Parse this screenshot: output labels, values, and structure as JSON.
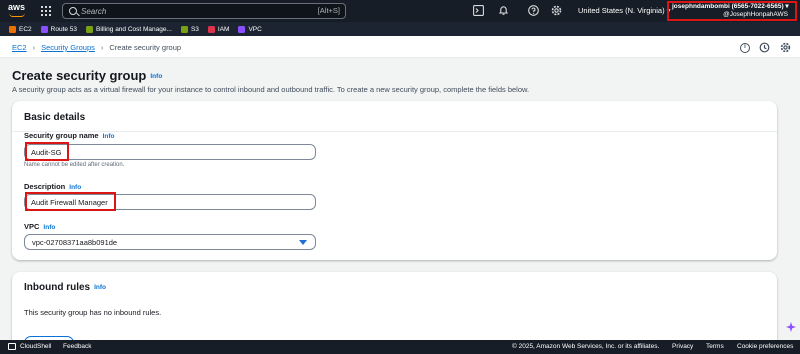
{
  "colors": {
    "nav_bg": "#161d26",
    "link": "#0972d3",
    "highlight": "#d91515",
    "aws_orange": "#ff9900"
  },
  "topnav": {
    "logo_text": "aws",
    "search_placeholder": "Search",
    "search_shortcut": "[Alt+S]",
    "region": "United States (N. Virginia) ▾",
    "account_name": "josephndambombi (6565-7022-6565) ▾",
    "account_alias": "@JosephHonpahAWS",
    "icons": [
      "apps-grid-icon",
      "terminal-icon",
      "bell-icon",
      "help-icon",
      "gear-icon"
    ]
  },
  "favorites": [
    {
      "label": "EC2",
      "color": "#ed7100"
    },
    {
      "label": "Route 53",
      "color": "#8c4fff"
    },
    {
      "label": "Billing and Cost Manage...",
      "color": "#7aa116"
    },
    {
      "label": "S3",
      "color": "#7aa116"
    },
    {
      "label": "IAM",
      "color": "#dd344c"
    },
    {
      "label": "VPC",
      "color": "#8c4fff"
    }
  ],
  "breadcrumb": {
    "items": [
      "EC2",
      "Security Groups"
    ],
    "current": "Create security group"
  },
  "page": {
    "title": "Create security group",
    "title_info": "Info",
    "description": "A security group acts as a virtual firewall for your instance to control inbound and outbound traffic. To create a new security group, complete the fields below."
  },
  "basic_details": {
    "title": "Basic details",
    "name_label": "Security group name",
    "name_info": "Info",
    "name_value": "Audit-SG",
    "name_hint": "Name cannot be edited after creation.",
    "desc_label": "Description",
    "desc_info": "Info",
    "desc_value": "Audit Firewall Manager",
    "vpc_label": "VPC",
    "vpc_info": "Info",
    "vpc_value": "vpc-02708371aa8b091de"
  },
  "inbound": {
    "title": "Inbound rules",
    "info": "Info",
    "empty_text": "This security group has no inbound rules."
  },
  "footer": {
    "cloudshell": "CloudShell",
    "feedback": "Feedback",
    "copyright": "© 2025, Amazon Web Services, Inc. or its affiliates.",
    "privacy": "Privacy",
    "terms": "Terms",
    "cookies": "Cookie preferences"
  }
}
